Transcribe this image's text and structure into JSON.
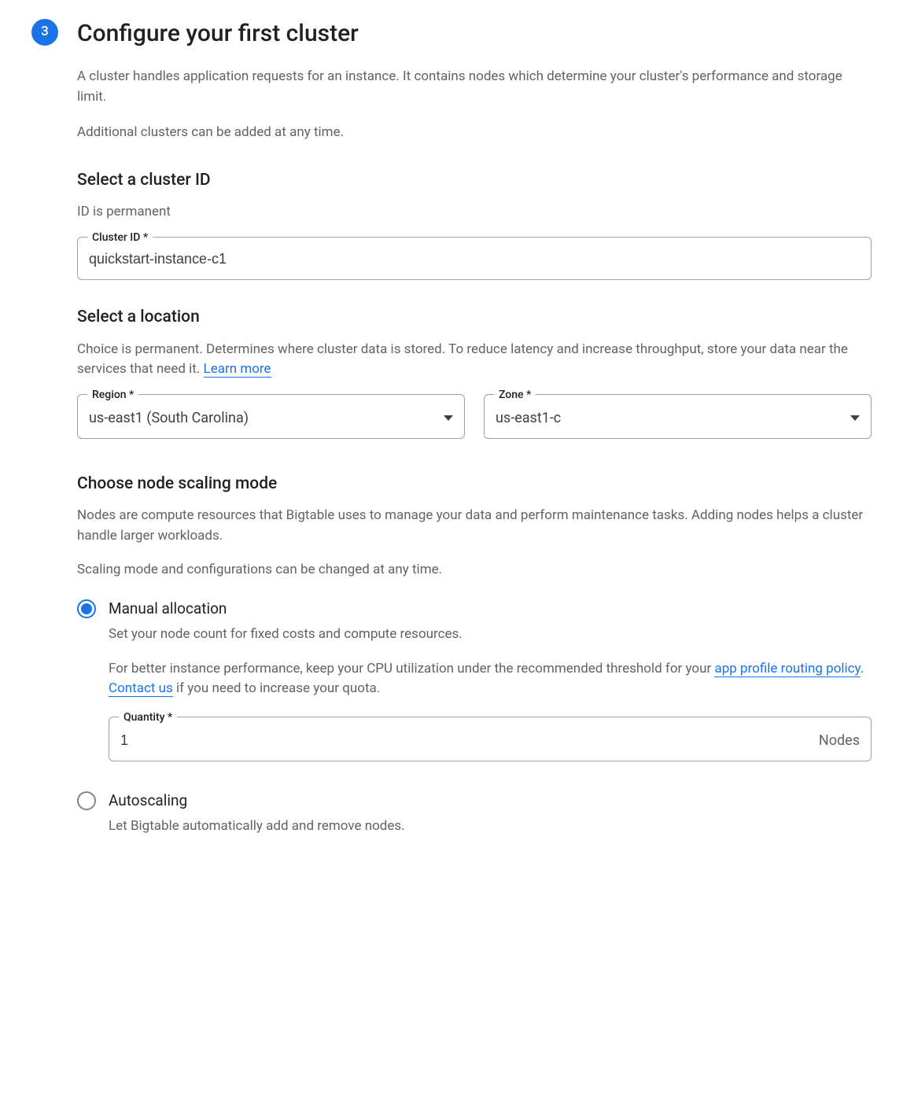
{
  "step": {
    "number": "3",
    "title": "Configure your first cluster",
    "description1": "A cluster handles application requests for an instance. It contains nodes which determine your cluster's performance and storage limit.",
    "description2": "Additional clusters can be added at any time."
  },
  "clusterId": {
    "heading": "Select a cluster ID",
    "caption": "ID is permanent",
    "label": "Cluster ID *",
    "value": "quickstart-instance-c1"
  },
  "location": {
    "heading": "Select a location",
    "caption_pre": "Choice is permanent. Determines where cluster data is stored. To reduce latency and increase throughput, store your data near the services that need it. ",
    "learn_more": "Learn more",
    "region_label": "Region *",
    "region_value": "us-east1 (South Carolina)",
    "zone_label": "Zone *",
    "zone_value": "us-east1-c"
  },
  "scaling": {
    "heading": "Choose node scaling mode",
    "desc1": "Nodes are compute resources that Bigtable uses to manage your data and perform maintenance tasks. Adding nodes helps a cluster handle larger workloads.",
    "desc2": "Scaling mode and configurations can be changed at any time.",
    "manual": {
      "title": "Manual allocation",
      "desc": "Set your node count for fixed costs and compute resources.",
      "perf_pre": "For better instance performance, keep your CPU utilization under the recommended threshold for your ",
      "link_policy": "app profile routing policy",
      "mid": ". ",
      "link_contact": "Contact us",
      "perf_post": " if you need to increase your quota.",
      "quantity_label": "Quantity *",
      "quantity_value": "1",
      "quantity_suffix": "Nodes"
    },
    "autoscaling": {
      "title": "Autoscaling",
      "desc": "Let Bigtable automatically add and remove nodes."
    }
  }
}
